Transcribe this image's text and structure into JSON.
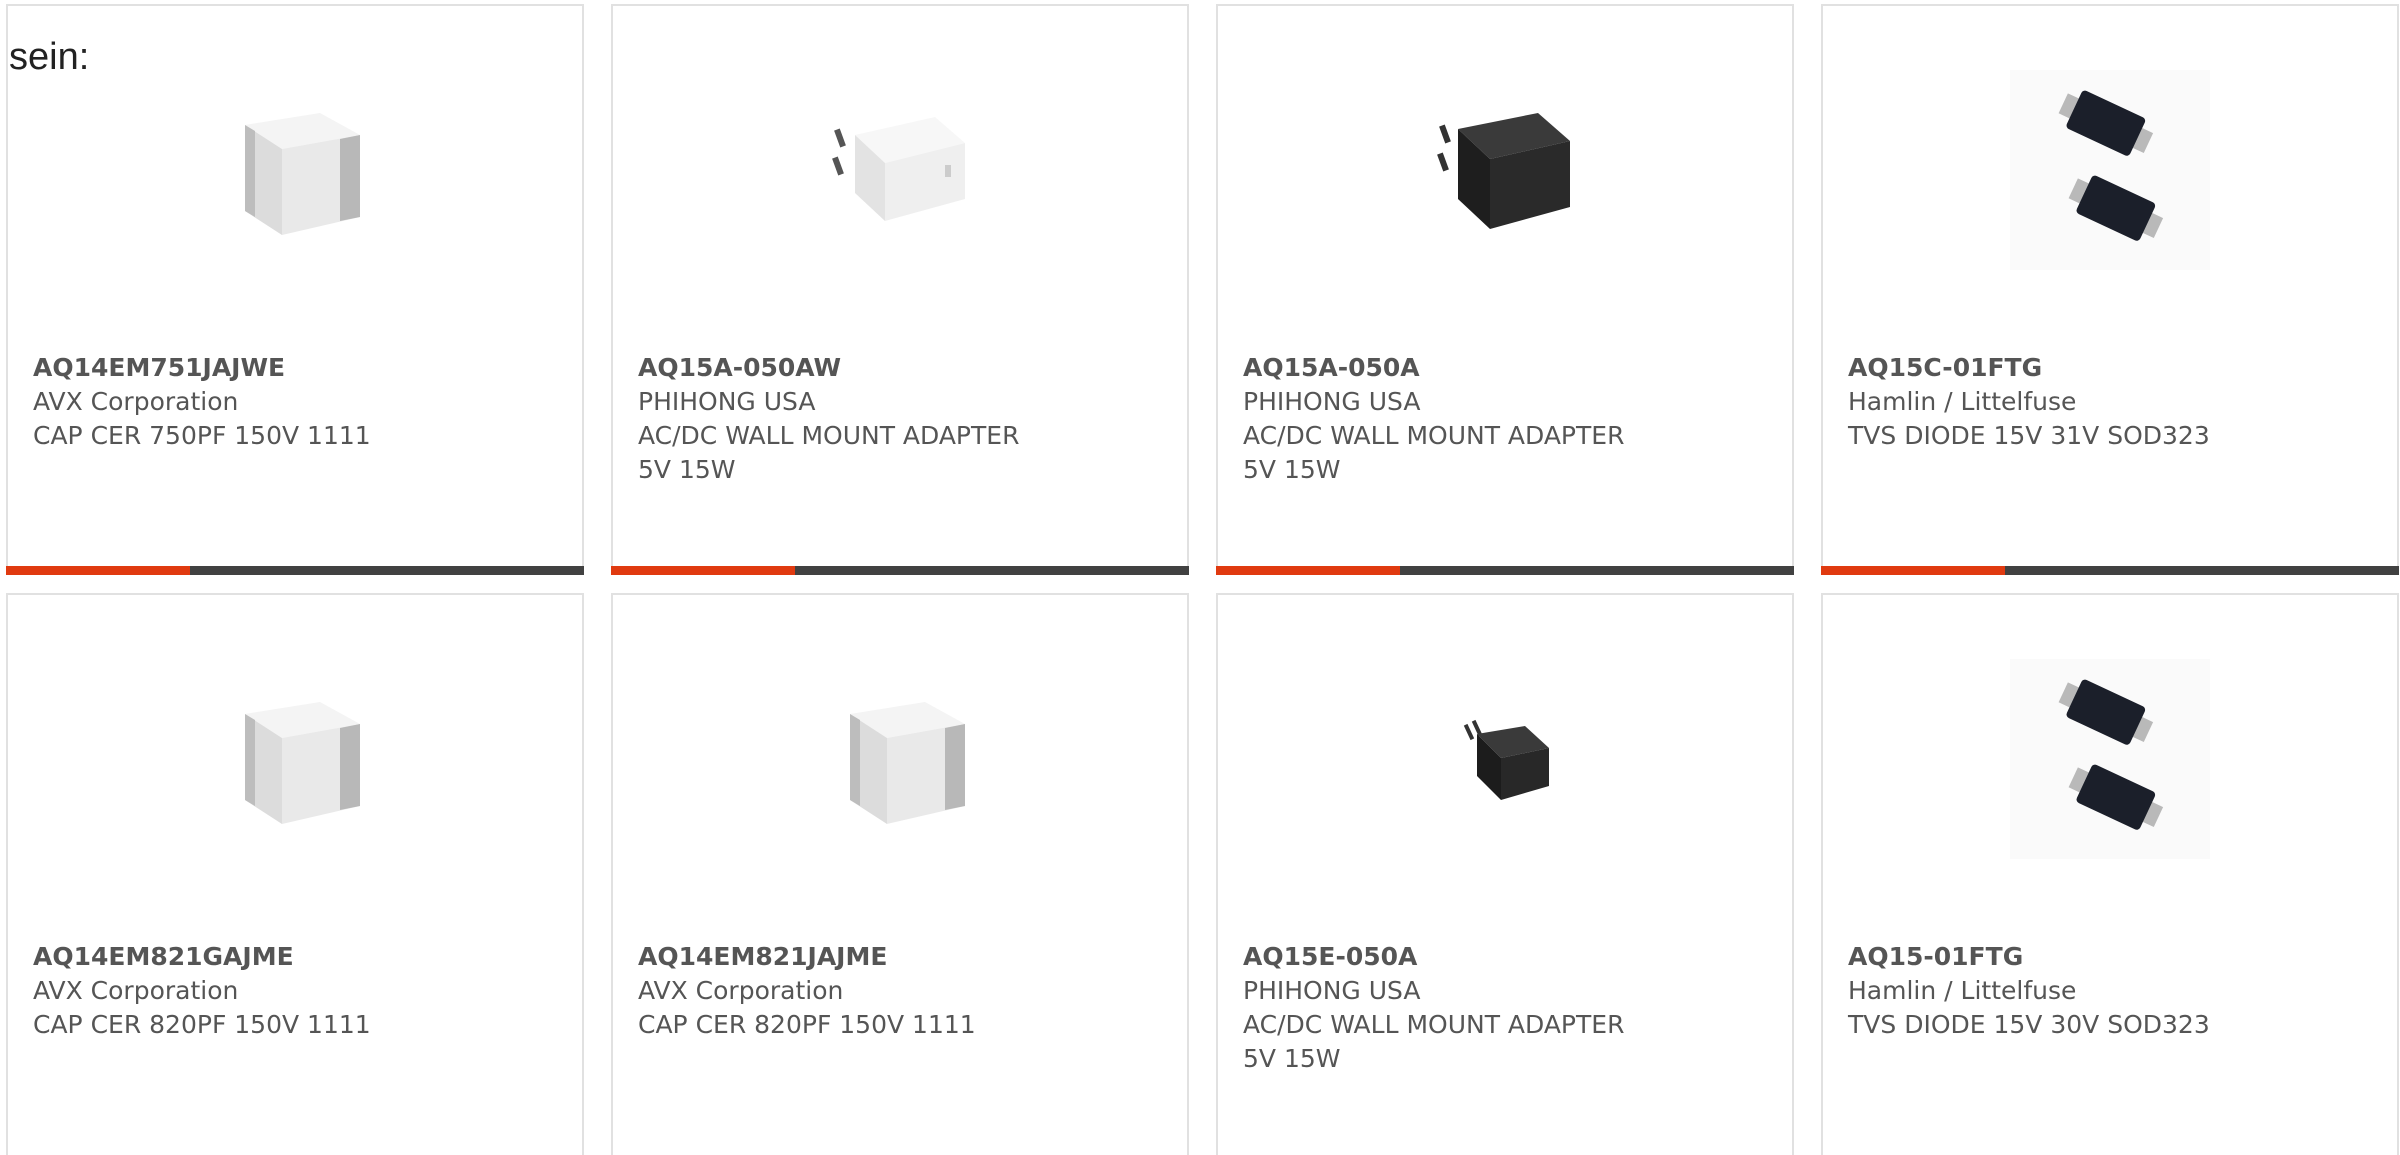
{
  "intro_text": "sein:",
  "products": [
    {
      "part": "AQ14EM751JAJWE",
      "manufacturer": "AVX Corporation",
      "description": "CAP CER 750PF 150V 1111",
      "image": "capacitor-cube-icon"
    },
    {
      "part": "AQ15A-050AW",
      "manufacturer": "PHIHONG USA",
      "description": "AC/DC WALL MOUNT ADAPTER",
      "description2": "5V 15W",
      "image": "white-wall-adapter-icon"
    },
    {
      "part": "AQ15A-050A",
      "manufacturer": "PHIHONG USA",
      "description": "AC/DC WALL MOUNT ADAPTER",
      "description2": "5V 15W",
      "image": "black-wall-adapter-icon"
    },
    {
      "part": "AQ15C-01FTG",
      "manufacturer": "Hamlin / Littelfuse",
      "description": "TVS DIODE 15V 31V SOD323",
      "image": "tvs-diode-icon"
    },
    {
      "part": "AQ14EM821GAJME",
      "manufacturer": "AVX Corporation",
      "description": "CAP CER 820PF 150V 1111",
      "image": "capacitor-cube-icon"
    },
    {
      "part": "AQ14EM821JAJME",
      "manufacturer": "AVX Corporation",
      "description": "CAP CER 820PF 150V 1111",
      "image": "capacitor-cube-icon"
    },
    {
      "part": "AQ15E-050A",
      "manufacturer": "PHIHONG USA",
      "description": "AC/DC WALL MOUNT ADAPTER",
      "description2": "5V 15W",
      "image": "black-eu-adapter-icon"
    },
    {
      "part": "AQ15-01FTG",
      "manufacturer": "Hamlin / Littelfuse",
      "description": "TVS DIODE 15V 30V SOD323",
      "image": "tvs-diode-icon"
    }
  ],
  "colors": {
    "accent": "#e03a10",
    "bar": "#414141",
    "border": "#e1e1e1",
    "text": "#555555"
  }
}
